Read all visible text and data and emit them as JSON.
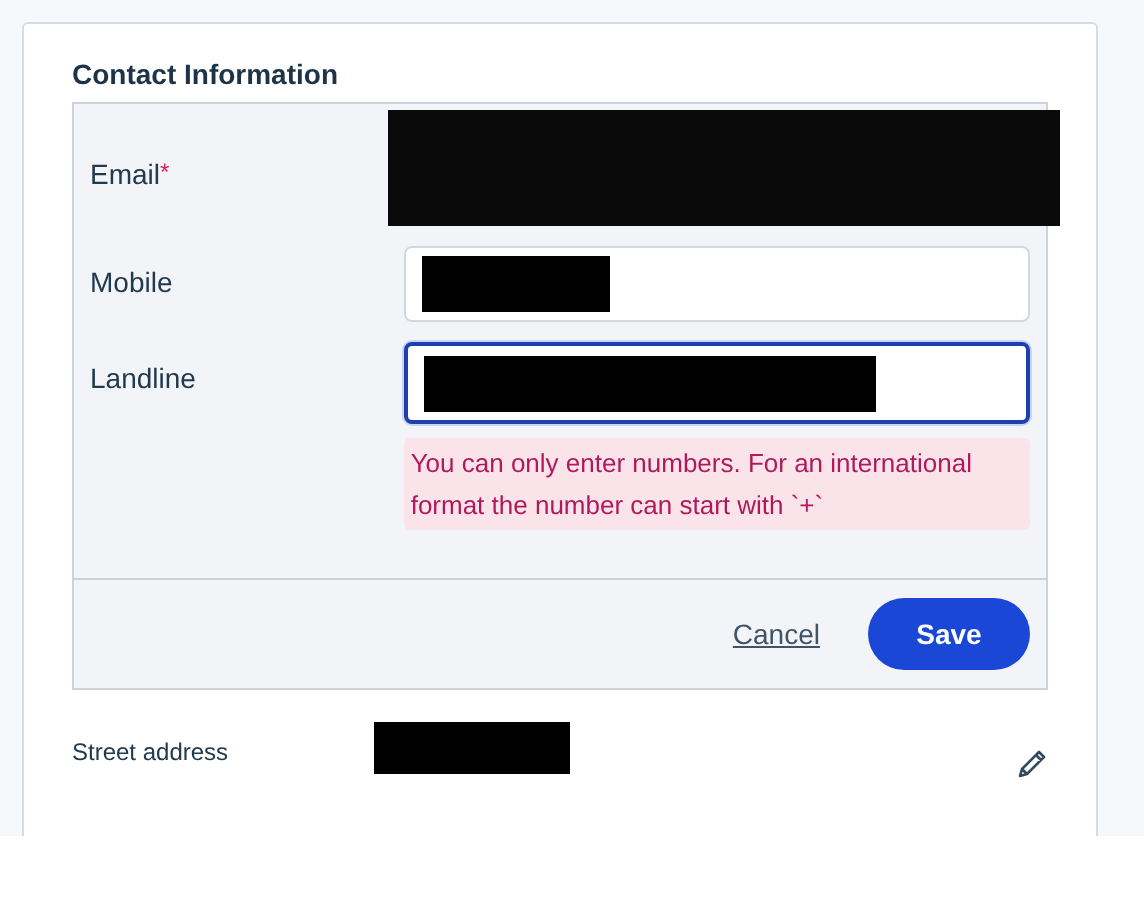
{
  "section": {
    "title": "Contact Information"
  },
  "fields": [
    {
      "label": "Email",
      "required_mark": "*",
      "kind": "covered"
    },
    {
      "label": "Mobile",
      "kind": "masked",
      "focused": false
    },
    {
      "label": "Landline",
      "kind": "masked",
      "focused": true,
      "error": "You can only enter numbers. For an international format the number can start with `+`"
    }
  ],
  "actions": {
    "cancel": "Cancel",
    "save": "Save"
  },
  "address": {
    "label": "Street address"
  }
}
